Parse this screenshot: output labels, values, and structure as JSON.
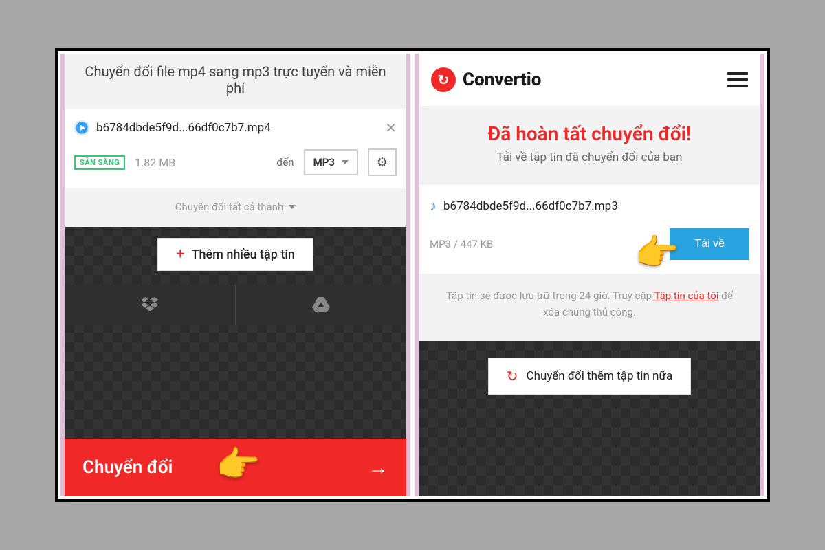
{
  "left": {
    "subtitle": "Chuyển đổi file mp4 sang mp3 trực tuyến và miễn phí",
    "file": {
      "name": "b6784dbde5f9d...66df0c7b7.mp4",
      "ready_label": "SẴN SÀNG",
      "size": "1.82 MB",
      "to_label": "đến",
      "target_format": "MP3"
    },
    "convert_all_label": "Chuyển đổi tất cả thành",
    "add_more_label": "Thêm nhiều tập tin",
    "convert_label": "Chuyển đổi"
  },
  "right": {
    "brand": "Convertio",
    "done_title": "Đã hoàn tất chuyển đổi!",
    "done_sub": "Tải về tập tin đã chuyển đổi của bạn",
    "file": {
      "name": "b6784dbde5f9d...66df0c7b7.mp3",
      "format_info": "MP3 / 447 KB"
    },
    "download_label": "Tải về",
    "notice_pre": "Tập tin sẽ được lưu trữ trong 24 giờ. Truy cập ",
    "notice_link": "Tập tin của tôi",
    "notice_post": " để xóa chúng thủ công.",
    "more_label": "Chuyển đổi thêm tập tin nữa"
  }
}
